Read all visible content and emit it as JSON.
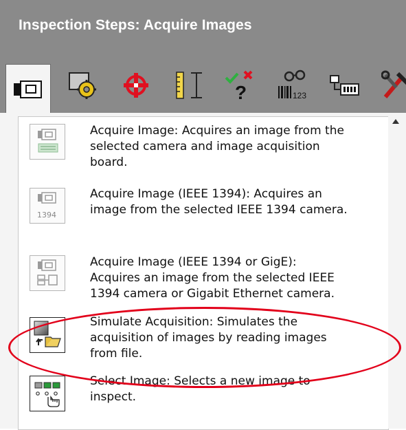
{
  "title": "Inspection Steps: Acquire Images",
  "toolbar": {
    "tabs": [
      {
        "name": "acquire-images-tab",
        "icon": "camera-icon"
      },
      {
        "name": "enhance-images-tab",
        "icon": "gear-image-icon"
      },
      {
        "name": "locate-features-tab",
        "icon": "crosshair-icon"
      },
      {
        "name": "measure-features-tab",
        "icon": "ruler-caliper-icon"
      },
      {
        "name": "check-for-presence-tab",
        "icon": "check-cross-question-icon"
      },
      {
        "name": "identify-parts-tab",
        "icon": "glasses-barcode-icon"
      },
      {
        "name": "use-additional-tools-tab",
        "icon": "communication-icon"
      },
      {
        "name": "tools-tab",
        "icon": "wrench-icon"
      }
    ]
  },
  "steps": [
    {
      "name": "acquire-image",
      "icon": "camera-board-icon",
      "text": "Acquire Image:  Acquires an image from the\nselected camera and image acquisition\nboard."
    },
    {
      "name": "acquire-image-ieee1394",
      "icon": "camera-1394-icon",
      "icon_label": "1394",
      "text": "Acquire Image (IEEE 1394):  Acquires an\nimage from the selected IEEE 1394 camera."
    },
    {
      "name": "acquire-image-ieee1394-gige",
      "icon": "camera-gige-icon",
      "text": "Acquire Image (IEEE 1394 or GigE):\nAcquires an image from the selected IEEE\n1394 camera or Gigabit Ethernet camera."
    },
    {
      "name": "simulate-acquisition",
      "icon": "folder-image-icon",
      "text": "Simulate Acquisition:  Simulates the\nacquisition of images by reading images\nfrom file."
    },
    {
      "name": "select-image",
      "icon": "select-image-hand-icon",
      "text": "Select Image:  Selects a new image to\ninspect."
    }
  ],
  "colors": {
    "title_bar": "#8a8a8a",
    "highlight": "#e2001a"
  }
}
